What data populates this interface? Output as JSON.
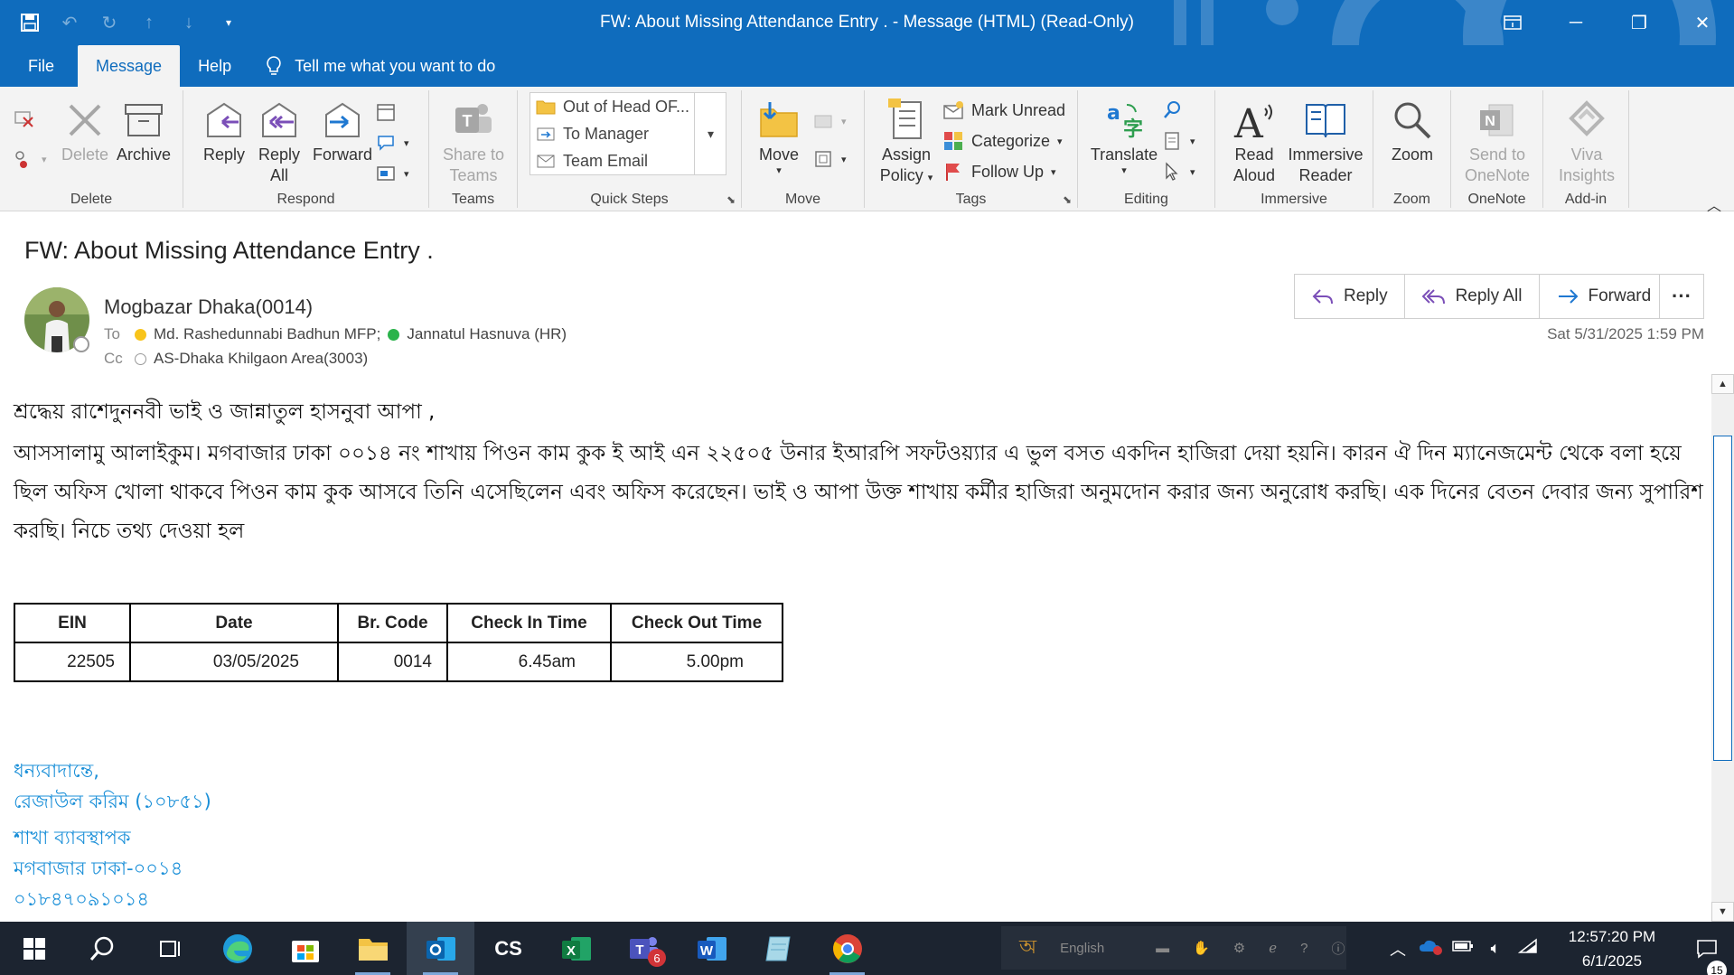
{
  "window": {
    "title": "FW: About Missing Attendance Entry .  -  Message (HTML) (Read-Only)"
  },
  "tabs": [
    {
      "label": "File"
    },
    {
      "label": "Message"
    },
    {
      "label": "Help"
    }
  ],
  "tellme": {
    "text": "Tell me what you want to do"
  },
  "ribbon": {
    "delete_group": {
      "delete": "Delete",
      "archive": "Archive",
      "label": "Delete"
    },
    "respond_group": {
      "reply": "Reply",
      "reply_all_1": "Reply",
      "reply_all_2": "All",
      "forward": "Forward",
      "label": "Respond"
    },
    "teams_group": {
      "share_1": "Share to",
      "share_2": "Teams",
      "label": "Teams"
    },
    "quick_steps": {
      "items": [
        "Out of Head OF...",
        "To Manager",
        "Team Email"
      ],
      "label": "Quick Steps"
    },
    "move_group": {
      "move": "Move",
      "label": "Move"
    },
    "tags_group": {
      "assign_1": "Assign",
      "assign_2": "Policy",
      "mark_unread": "Mark Unread",
      "categorize": "Categorize",
      "follow_up": "Follow Up",
      "label": "Tags"
    },
    "editing_group": {
      "translate": "Translate",
      "label": "Editing"
    },
    "immersive_group": {
      "read_1": "Read",
      "read_2": "Aloud",
      "immersive_1": "Immersive",
      "immersive_2": "Reader",
      "label": "Immersive"
    },
    "zoom_group": {
      "zoom": "Zoom",
      "label": "Zoom"
    },
    "onenote_group": {
      "send_1": "Send to",
      "send_2": "OneNote",
      "label": "OneNote"
    },
    "addin_group": {
      "viva_1": "Viva",
      "viva_2": "Insights",
      "label": "Add-in"
    }
  },
  "message": {
    "subject": "FW: About Missing Attendance Entry .",
    "sender": "Mogbazar Dhaka(0014)",
    "to_label": "To",
    "to": [
      {
        "name": "Md. Rashedunnabi Badhun MFP;",
        "status": "away"
      },
      {
        "name": "Jannatul Hasnuva (HR)",
        "status": "available"
      }
    ],
    "cc_label": "Cc",
    "cc": [
      {
        "name": "AS-Dhaka Khilgaon Area(3003)",
        "status": "offline"
      }
    ],
    "date": "Sat 5/31/2025 1:59 PM",
    "actions": {
      "reply": "Reply",
      "reply_all": "Reply All",
      "forward": "Forward"
    }
  },
  "body": {
    "greeting": "শ্রদ্ধেয় রাশেদুননবী ভাই ও  জান্নাতুল হাসনুবা আপা ,",
    "paragraph": "আসসালামু আলাইকুম। মগবাজার ঢাকা ০০১৪ নং শাখায় পিওন কাম কুক ই আই এন ২২৫০৫  উনার ইআরপি  সফটওয়্যার এ  ভুল বসত একদিন হাজিরা দেয়া  হয়নি। কারন ঐ দিন ম্যানেজমেন্ট থেকে বলা হয়ে ছিল অফিস খোলা থাকবে পিওন কাম কুক আসবে  তিনি এসেছিলেন এবং অফিস করেছেন।   ভাই ও আপা  উক্ত শাখায় কর্মীর হাজিরা অনুমদোন করার জন্য অনুরোধ করছি। এক দিনের বেতন দেবার জন্য সুপারিশ করছি। নিচে তথ্য দেওয়া হল"
  },
  "table": {
    "headers": [
      "EIN",
      "Date",
      "Br. Code",
      "Check In Time",
      "Check Out Time"
    ],
    "rows": [
      [
        "22505",
        "03/05/2025",
        "0014",
        "6.45am",
        "5.00pm"
      ]
    ]
  },
  "signature": {
    "lines": [
      "ধন্যবাদান্তে,",
      "রেজাউল করিম  (১০৮৫১)",
      "শাখা ব্যাবস্থাপক",
      "মগবাজার  ঢাকা-০০১৪",
      "০১৮৪৭০৯১০১৪"
    ]
  },
  "taskbar": {
    "lang": "English",
    "time": "12:57:20 PM",
    "date": "6/1/2025",
    "teams_badge": "6",
    "notif_count": "15",
    "cs_label": "CS"
  },
  "colors": {
    "accent": "#0f6cbd",
    "signature": "#1a8fd8"
  }
}
